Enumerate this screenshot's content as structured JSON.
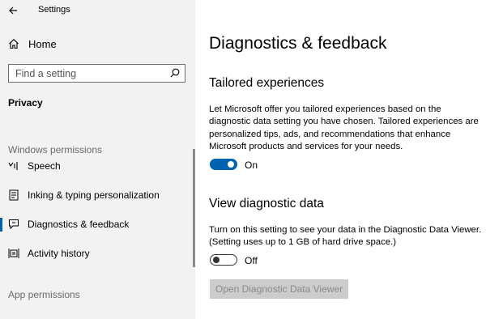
{
  "app": {
    "title": "Settings"
  },
  "sidebar": {
    "home_label": "Home",
    "search": {
      "placeholder": "Find a setting",
      "value": ""
    },
    "section_label": "Privacy",
    "group_windows": "Windows permissions",
    "items": [
      {
        "label": "Speech",
        "icon": "speech-icon"
      },
      {
        "label": "Inking & typing personalization",
        "icon": "inking-icon"
      },
      {
        "label": "Diagnostics & feedback",
        "icon": "feedback-icon",
        "selected": true
      },
      {
        "label": "Activity history",
        "icon": "activity-history-icon"
      }
    ],
    "group_app": "App permissions"
  },
  "main": {
    "title": "Diagnostics & feedback",
    "tailored": {
      "heading": "Tailored experiences",
      "description": "Let Microsoft offer you tailored experiences based on the diagnostic data setting you have chosen. Tailored experiences are personalized tips, ads, and recommendations that enhance Microsoft products and services for your needs.",
      "toggle_state": "On"
    },
    "view_data": {
      "heading": "View diagnostic data",
      "description": "Turn on this setting to see your data in the Diagnostic Data Viewer. (Setting uses up to 1 GB of hard drive space.)",
      "toggle_state": "Off",
      "button_label": "Open Diagnostic Data Viewer"
    }
  },
  "colors": {
    "accent": "#0063b1",
    "sidebar_bg": "#f2f2f2",
    "disabled_button_bg": "#cccccc"
  }
}
